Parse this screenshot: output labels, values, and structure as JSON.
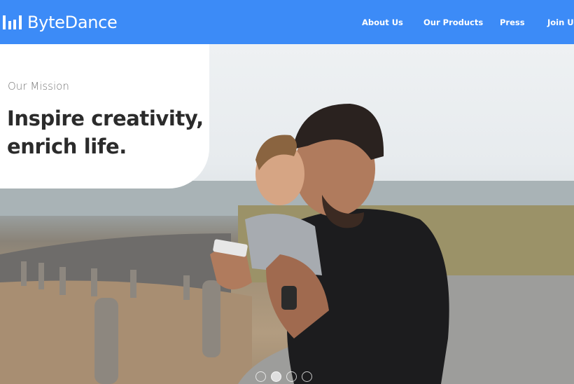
{
  "header": {
    "brand": "ByteDance",
    "logo_icon": "bar-chart-logo-icon",
    "background_color": "#3c8bf7",
    "nav": [
      {
        "label": "About Us"
      },
      {
        "label": "Our Products"
      },
      {
        "label": "Press"
      },
      {
        "label": "Join Us"
      }
    ]
  },
  "hero": {
    "image_description": "Father and son laughing while looking at a smartphone by the coast",
    "mission_label": "Our Mission",
    "mission_title": "Inspire creativity, enrich life."
  },
  "carousel": {
    "slide_count": 4,
    "active_index": 1
  }
}
